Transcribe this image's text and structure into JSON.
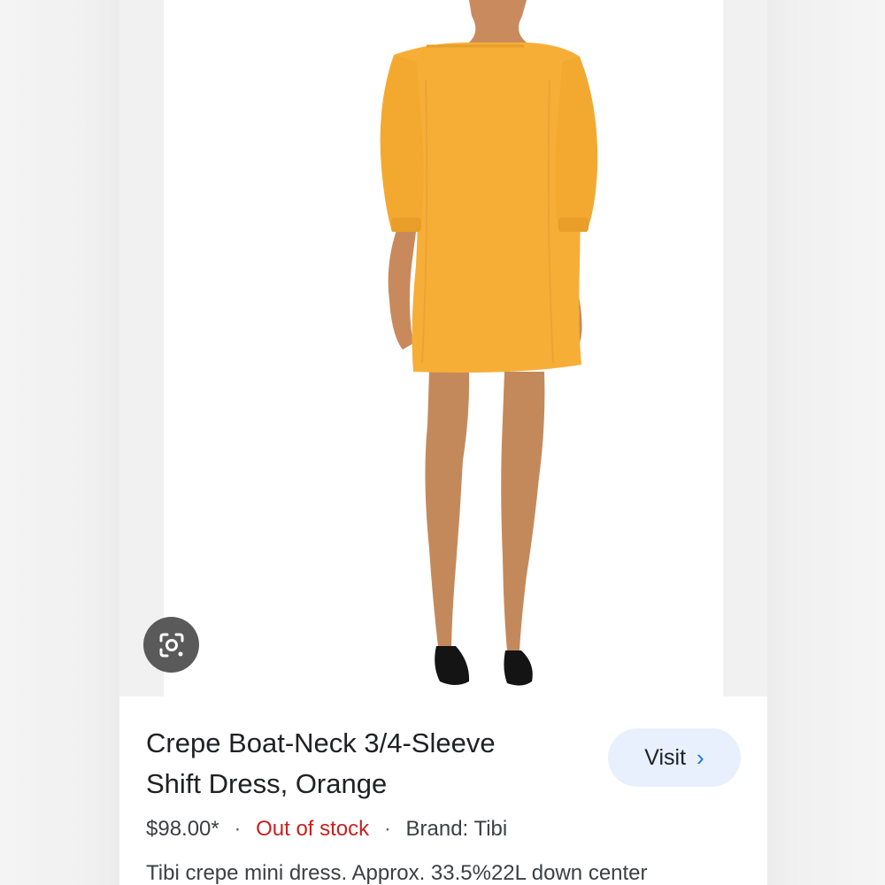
{
  "product": {
    "title_line1": "Crepe Boat-Neck 3/4-Sleeve",
    "title_line2": "Shift Dress, Orange",
    "price": "$98.00*",
    "separator": "·",
    "stock_status": "Out of stock",
    "brand": "Brand: Tibi",
    "description": "Tibi crepe mini dress. Approx. 33.5%22L down center"
  },
  "visit_button": {
    "label": "Visit",
    "chevron": "›"
  },
  "icons": {
    "lens": "google-lens-icon"
  },
  "colors": {
    "dress": "#f7ae37",
    "stock_red": "#c5221f",
    "visit_bg": "#e8f0fe",
    "accent_blue": "#1a73e8"
  }
}
